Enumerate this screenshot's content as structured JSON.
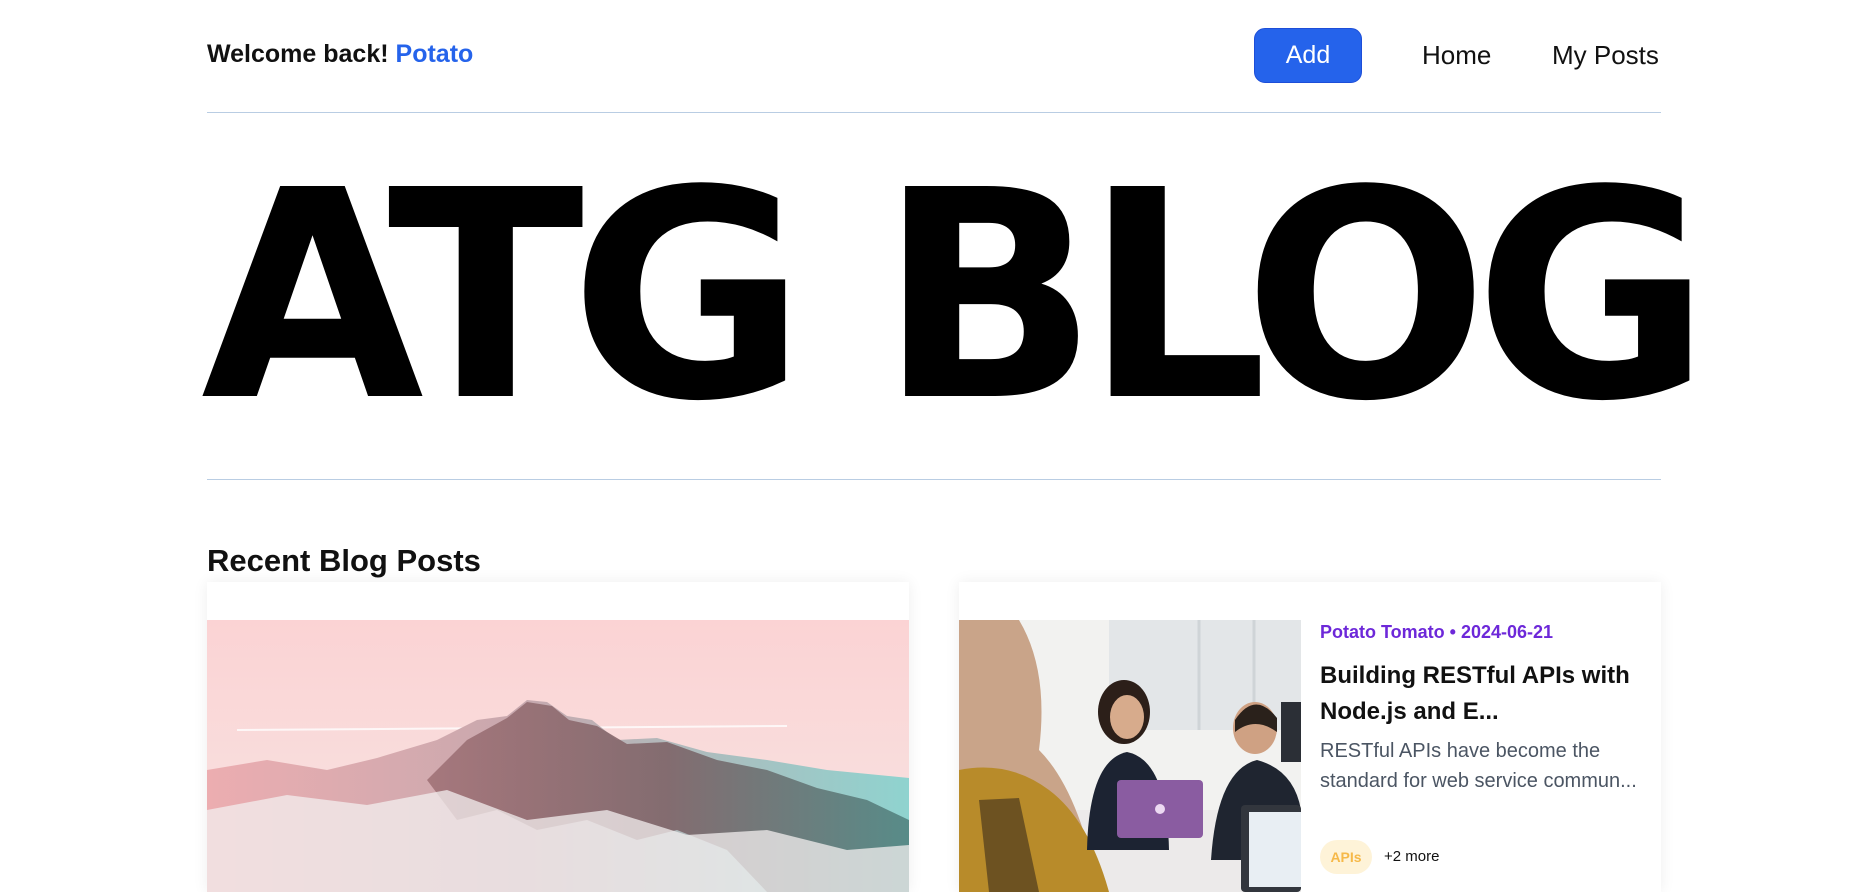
{
  "header": {
    "welcome_text": "Welcome back!",
    "username": "Potato",
    "add_label": "Add",
    "nav": {
      "home": "Home",
      "my_posts": "My Posts"
    }
  },
  "hero": {
    "title": "ATG BLOG"
  },
  "section": {
    "title": "Recent Blog Posts"
  },
  "posts": [
    {
      "image": "mountain-image"
    },
    {
      "image": "office-image",
      "meta": "Potato Tomato • 2024-06-21",
      "title": "Building RESTful APIs with Node.js and E...",
      "excerpt": "RESTful APIs have become the standard for web service commun...",
      "tag": "APIs",
      "more_tags": "+2 more"
    }
  ],
  "colors": {
    "accent": "#2563eb",
    "meta": "#6d28d9",
    "tag_bg": "#fef3d8",
    "tag_text": "#f6b949",
    "divider": "#b9cde3"
  }
}
